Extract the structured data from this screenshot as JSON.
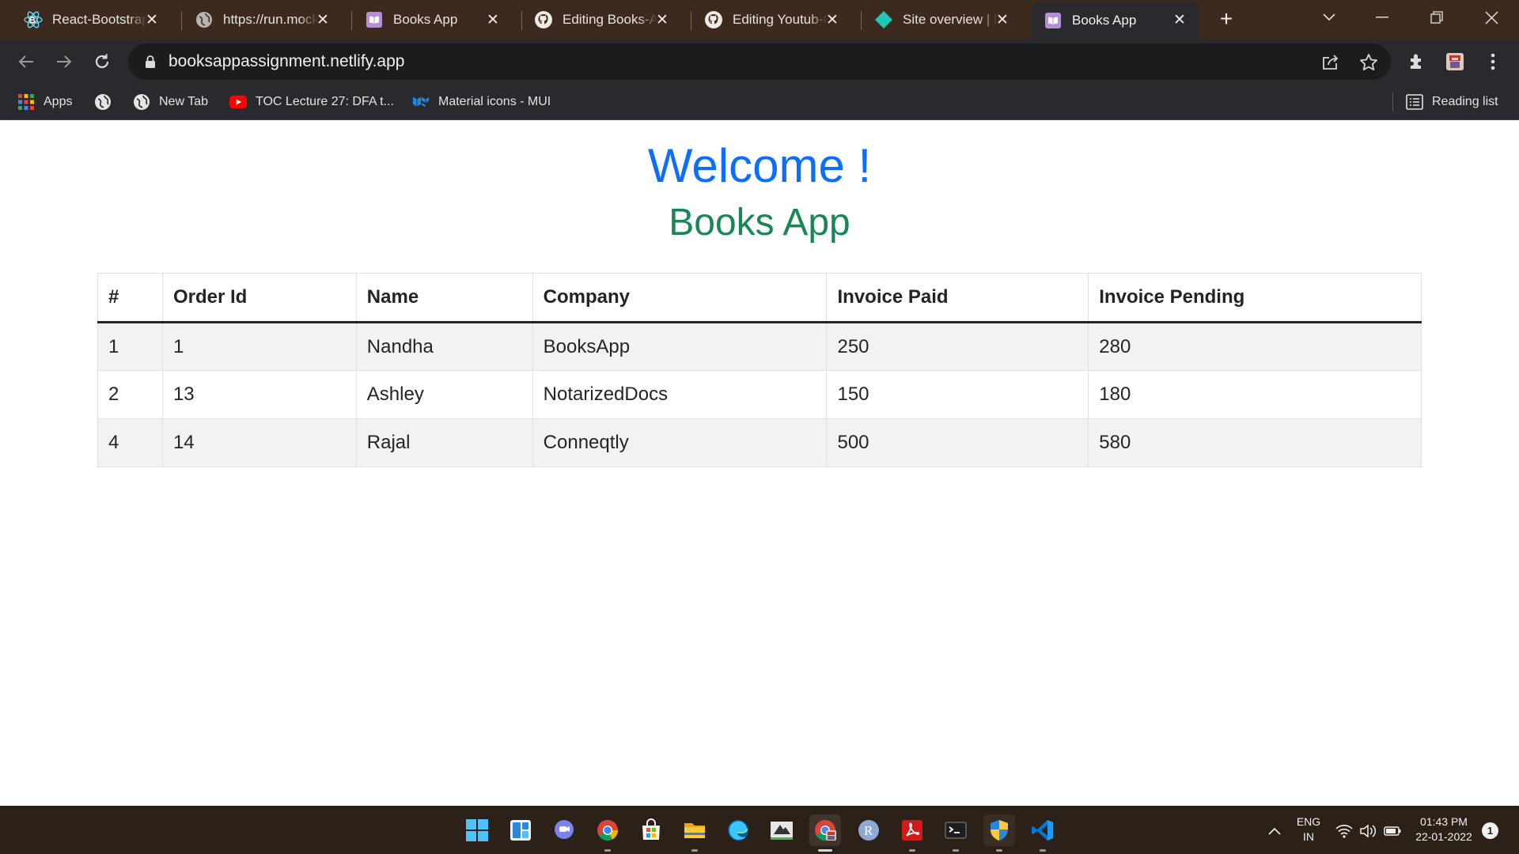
{
  "browser": {
    "tabs": [
      {
        "title": "React-Bootstrap",
        "icon": "react-bootstrap-icon"
      },
      {
        "title": "https://run.mocky",
        "icon": "globe-icon"
      },
      {
        "title": "Books App",
        "icon": "book-icon"
      },
      {
        "title": "Editing Books-App",
        "icon": "github-icon"
      },
      {
        "title": "Editing Youtub-Clone",
        "icon": "github-icon"
      },
      {
        "title": "Site overview | books",
        "icon": "netlify-icon"
      },
      {
        "title": "Books App",
        "icon": "book-icon",
        "active": true
      }
    ],
    "url": "booksappassignment.netlify.app",
    "bookmarks": [
      {
        "label": "Apps",
        "icon": "apps-grid-icon"
      },
      {
        "label": "",
        "icon": "globe-icon"
      },
      {
        "label": "New Tab",
        "icon": "globe-icon"
      },
      {
        "label": "TOC Lecture 27: DFA t...",
        "icon": "youtube-icon"
      },
      {
        "label": "Material icons - MUI",
        "icon": "mui-icon"
      }
    ],
    "reading_list_label": "Reading list"
  },
  "page": {
    "welcome": "Welcome !",
    "title": "Books App",
    "table": {
      "headers": [
        "#",
        "Order Id",
        "Name",
        "Company",
        "Invoice Paid",
        "Invoice Pending"
      ],
      "rows": [
        [
          "1",
          "1",
          "Nandha",
          "BooksApp",
          "250",
          "280"
        ],
        [
          "2",
          "13",
          "Ashley",
          "NotarizedDocs",
          "150",
          "180"
        ],
        [
          "4",
          "14",
          "Rajal",
          "Conneqtly",
          "500",
          "580"
        ]
      ]
    }
  },
  "taskbar": {
    "apps": [
      "windows-start-icon",
      "widgets-icon",
      "teams-chat-icon",
      "chrome-icon",
      "microsoft-store-icon",
      "file-explorer-icon",
      "edge-icon",
      "snipping-tool-icon",
      "chrome-profile-icon",
      "r-app-icon",
      "acrobat-icon",
      "terminal-icon",
      "security-icon",
      "vscode-icon"
    ],
    "language": "ENG",
    "region": "IN",
    "time": "01:43 PM",
    "date": "22-01-2022",
    "notifications": "1"
  },
  "colors": {
    "welcome": "#0d6efd",
    "title": "#198754",
    "tabstrip": "#3b2a1d",
    "toolbar": "#2a2a2e"
  }
}
